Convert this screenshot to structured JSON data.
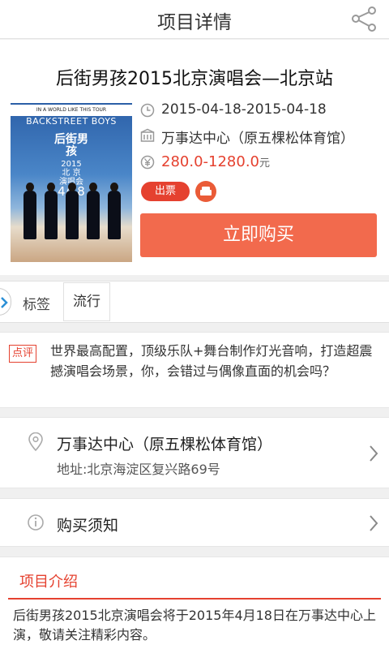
{
  "header": {
    "title": "项目详情",
    "share_icon": "share-icon"
  },
  "event": {
    "name": "后街男孩2015北京演唱会—北京站",
    "date_range": "2015-04-18-2015-04-18",
    "venue": "万事达中心（原五棵松体育馆）",
    "price": "280.0-1280.0",
    "price_unit": "元",
    "badge": "出票",
    "buy_label": "立即购买",
    "accent_color": "#e5412f"
  },
  "poster": {
    "tagline": "IN A WORLD LIKE THIS TOUR",
    "band": "BACKSTREET BOYS",
    "cn_name": "后街男孩",
    "year": "2015",
    "city": "北 京",
    "show": "演唱会",
    "date": "4/18"
  },
  "tags": {
    "label": "标签",
    "items": [
      "流行"
    ]
  },
  "review": {
    "label": "点评",
    "text": "世界最高配置，顶级乐队+舞台制作灯光音响，打造超震撼演唱会场景，你，会错过与偶像直面的机会吗？"
  },
  "venue_section": {
    "name": "万事达中心（原五棵松体育馆）",
    "address": "地址:北京海淀区复兴路69号"
  },
  "notice": {
    "label": "购买须知"
  },
  "intro": {
    "heading": "项目介绍",
    "text": "后街男孩2015北京演唱会将于2015年4月18日在万事达中心上演，敬请关注精彩内容。"
  }
}
